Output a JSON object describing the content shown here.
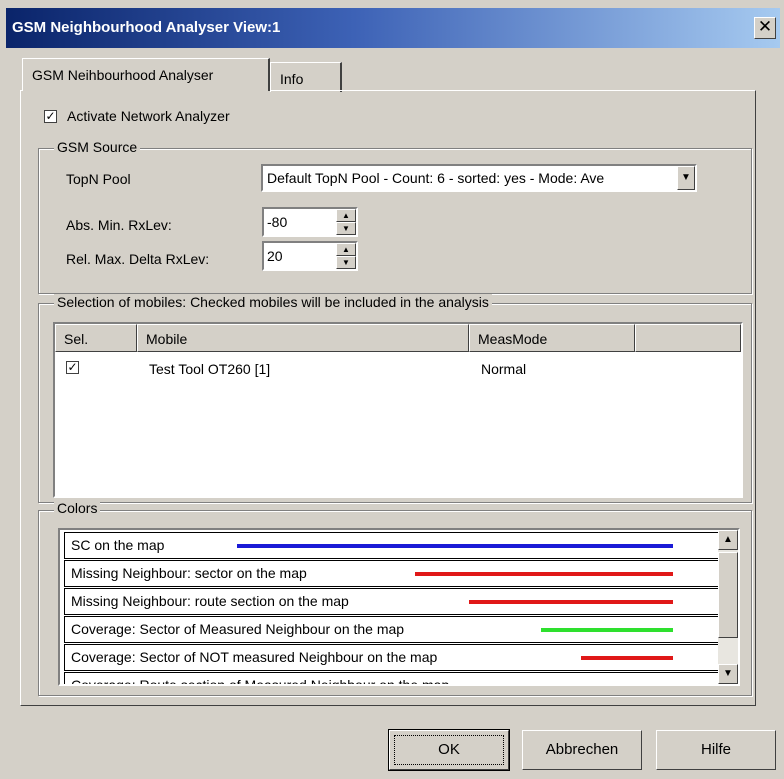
{
  "window": {
    "title": "GSM Neighbourhood Analyser View:1",
    "close_glyph": "✕"
  },
  "tabs": [
    {
      "label": "GSM Neihbourhood Analyser",
      "active": true
    },
    {
      "label": "Info",
      "active": false
    }
  ],
  "activate": {
    "label": "Activate Network Analyzer",
    "checked": true,
    "check_glyph": "✓"
  },
  "gsm_source": {
    "legend": "GSM Source",
    "topn_label": "TopN Pool",
    "topn_value": "Default TopN Pool - Count: 6 - sorted: yes - Mode: Ave",
    "abs_min_label": "Abs. Min. RxLev:",
    "abs_min_value": "-80",
    "rel_max_label": "Rel. Max. Delta RxLev:",
    "rel_max_value": "20"
  },
  "mobiles": {
    "legend": "Selection of mobiles: Checked mobiles will be included in the analysis",
    "columns": [
      "Sel.",
      "Mobile",
      "MeasMode"
    ],
    "rows": [
      {
        "checked": true,
        "mobile": "Test Tool OT260 [1]",
        "meas_mode": "Normal"
      }
    ]
  },
  "colors": {
    "legend": "Colors",
    "items": [
      {
        "label": "SC on the map",
        "color": "#1a1ad6"
      },
      {
        "label": "Missing Neighbour: sector on the map",
        "color": "#e01818"
      },
      {
        "label": "Missing Neighbour: route section on the map",
        "color": "#e01818"
      },
      {
        "label": "Coverage: Sector of Measured Neighbour on the map",
        "color": "#2ee02e"
      },
      {
        "label": "Coverage: Sector of NOT measured Neighbour on the map",
        "color": "#e01818"
      },
      {
        "label": "Coverage: Route section of Measured Neighbour on the map",
        "color": "#2ee02e"
      }
    ]
  },
  "buttons": {
    "ok": "OK",
    "cancel": "Abbrechen",
    "help": "Hilfe"
  },
  "icons": {
    "checkbox": "checkmark-icon",
    "dropdown": "dropdown-arrow-icon",
    "scroll_up": "scroll-up-icon",
    "scroll_down": "scroll-down-icon"
  }
}
